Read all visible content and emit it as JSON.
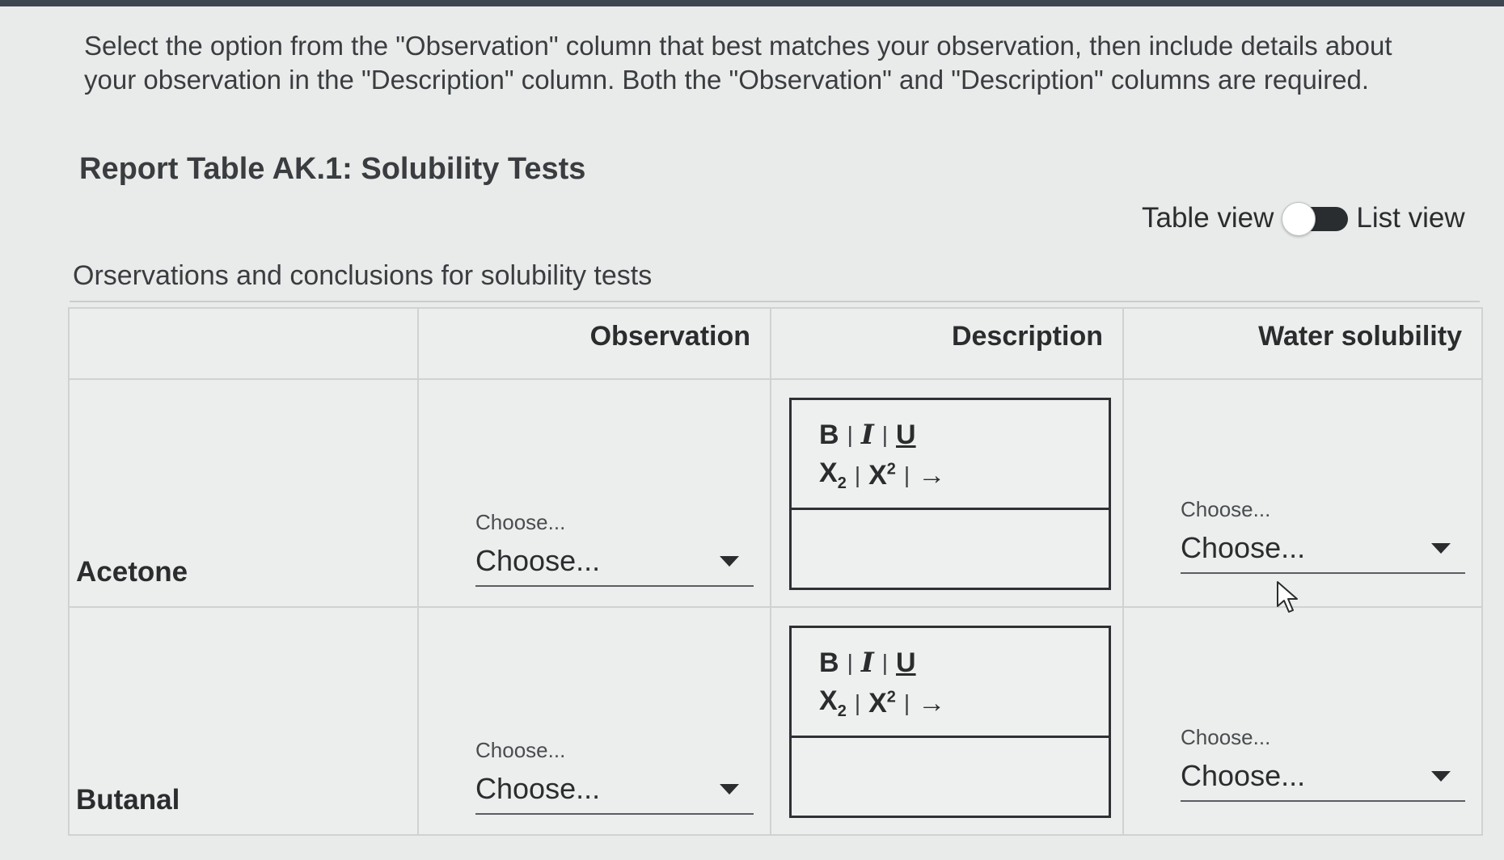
{
  "instructions": "Select the option from the \"Observation\" column that best matches your observation, then include details about your observation in the \"Description\" column. Both the \"Observation\" and \"Description\" columns are required.",
  "report_title": "Report Table AK.1: Solubility Tests",
  "view_toggle": {
    "left_label": "Table view",
    "right_label": "List view"
  },
  "table": {
    "caption": "Orservations and conclusions for solubility tests",
    "headers": [
      "",
      "Observation",
      "Description",
      "Water solubility"
    ],
    "rows": [
      {
        "label": "Acetone",
        "observation": {
          "label": "Choose...",
          "value": "Choose..."
        },
        "water_solubility": {
          "label": "Choose...",
          "value": "Choose..."
        }
      },
      {
        "label": "Butanal",
        "observation": {
          "label": "Choose...",
          "value": "Choose..."
        },
        "water_solubility": {
          "label": "Choose...",
          "value": "Choose..."
        }
      }
    ]
  },
  "editor_toolbar": {
    "bold": "B",
    "italic": "I",
    "underline": "U",
    "subscript_base": "X",
    "subscript": "2",
    "superscript_base": "X",
    "superscript": "2",
    "arrow": "→",
    "separator": "|"
  }
}
